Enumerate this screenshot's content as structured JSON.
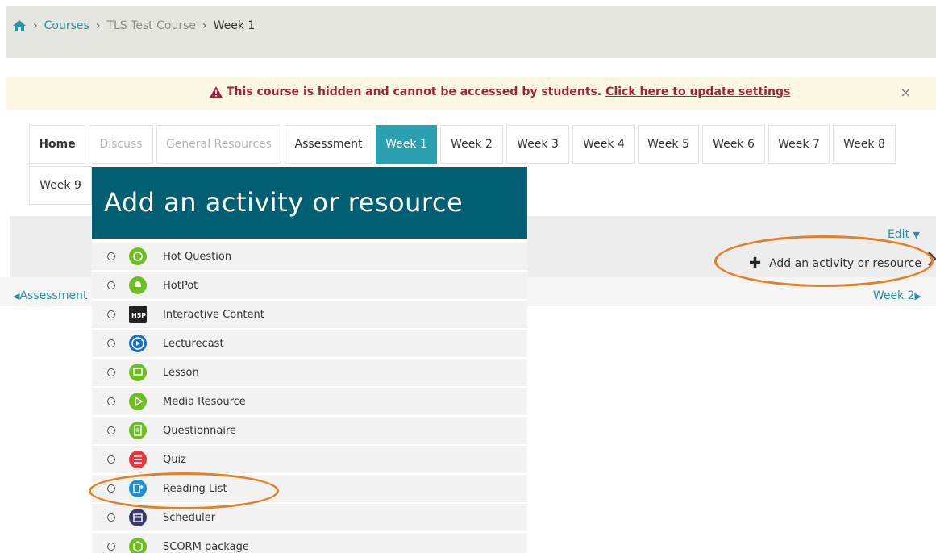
{
  "breadcrumb": {
    "items": [
      {
        "label": "Courses"
      },
      {
        "label": "TLS Test Course"
      },
      {
        "label": "Week 1"
      }
    ]
  },
  "alert": {
    "message": "This course is hidden and cannot be accessed by students.",
    "link": "Click here to update settings",
    "close": "×"
  },
  "tabs": [
    {
      "label": "Home"
    },
    {
      "label": "Discuss"
    },
    {
      "label": "General Resources"
    },
    {
      "label": "Assessment"
    },
    {
      "label": "Week 1"
    },
    {
      "label": "Week 2"
    },
    {
      "label": "Week 3"
    },
    {
      "label": "Week 4"
    },
    {
      "label": "Week 5"
    },
    {
      "label": "Week 6"
    },
    {
      "label": "Week 7"
    },
    {
      "label": "Week 8"
    },
    {
      "label": "Week 9"
    }
  ],
  "section": {
    "edit": "Edit",
    "add": "Add an activity or resource",
    "prev": "Assessment",
    "next": "Week 2"
  },
  "modal": {
    "title": "Add an activity or resource",
    "items": [
      {
        "label": "Hot Question",
        "icon": "hot-question-icon",
        "color": "#6cbf1f"
      },
      {
        "label": "HotPot",
        "icon": "hotpot-icon",
        "color": "#6cbf1f"
      },
      {
        "label": "Interactive Content",
        "icon": "h5p-icon",
        "color": "#222222"
      },
      {
        "label": "Lecturecast",
        "icon": "lecturecast-icon",
        "color": "#1a6fc9"
      },
      {
        "label": "Lesson",
        "icon": "lesson-icon",
        "color": "#6cbf1f"
      },
      {
        "label": "Media Resource",
        "icon": "media-resource-icon",
        "color": "#6cbf1f"
      },
      {
        "label": "Questionnaire",
        "icon": "questionnaire-icon",
        "color": "#6cbf1f"
      },
      {
        "label": "Quiz",
        "icon": "quiz-icon",
        "color": "#e8383d"
      },
      {
        "label": "Reading List",
        "icon": "reading-list-icon",
        "color": "#1a8fd6"
      },
      {
        "label": "Scheduler",
        "icon": "scheduler-icon",
        "color": "#3a3a6e"
      },
      {
        "label": "SCORM package",
        "icon": "scorm-icon",
        "color": "#6cbf1f"
      }
    ]
  },
  "colors": {
    "accent": "#2aa0b0",
    "modal_header": "#005f73",
    "annotation": "#e67e22",
    "alert_text": "#a8203d"
  }
}
